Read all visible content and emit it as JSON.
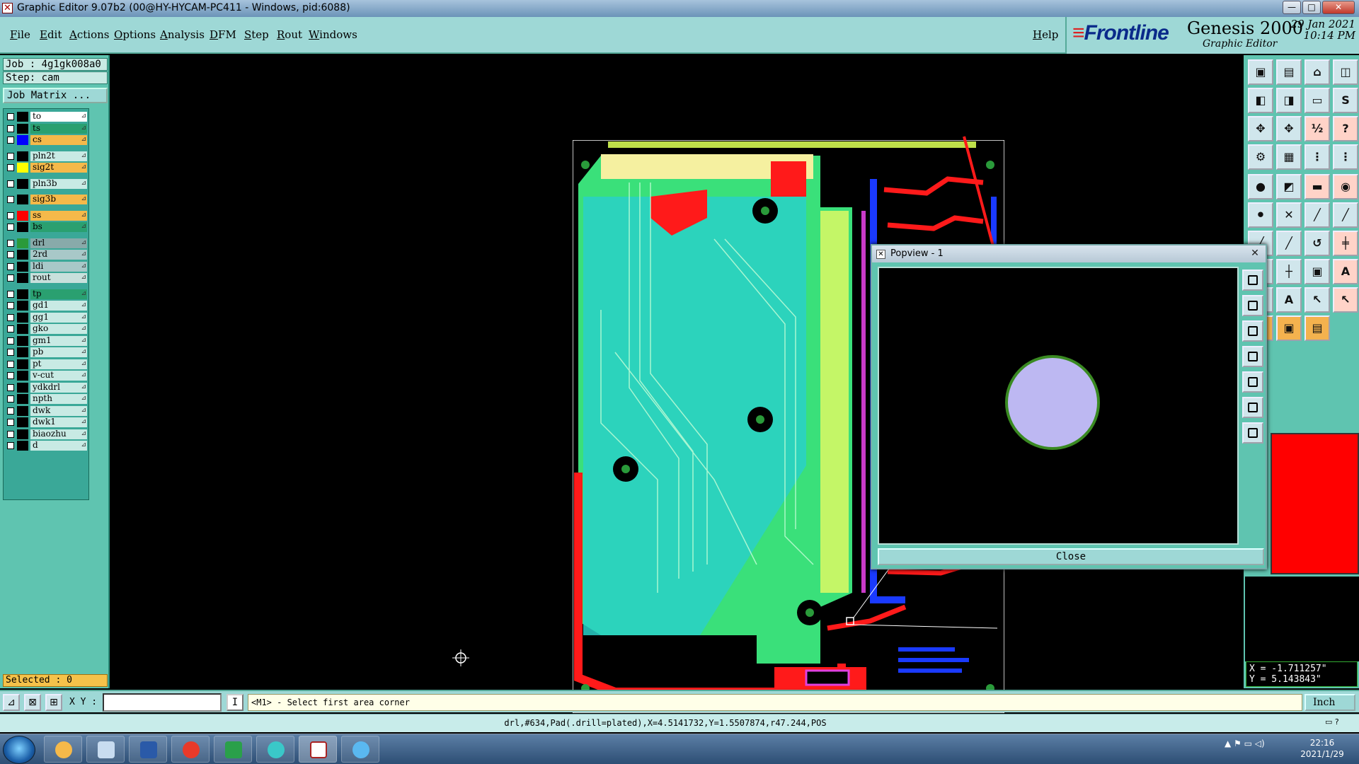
{
  "window": {
    "title": "Graphic Editor 9.07b2 (00@HY-HYCAM-PC411 - Windows, pid:6088)",
    "controls": [
      "—",
      "□",
      "✕"
    ]
  },
  "menu": [
    "File",
    "Edit",
    "Actions",
    "Options",
    "Analysis",
    "DFM",
    "Step",
    "Rout",
    "Windows"
  ],
  "help": "Help",
  "brand": {
    "logo": "Frontline",
    "product": "Genesis 2000",
    "subtitle": "Graphic Editor",
    "date": "29 Jan 2021",
    "time": "10:14 PM"
  },
  "job": {
    "job_line": "Job : 4g1gk008a0",
    "step_line": "Step: cam",
    "matrix_button": "Job Matrix ..."
  },
  "layers": [
    {
      "name": "to",
      "color": "#ffffff",
      "swatch": "#000000"
    },
    {
      "name": "ts",
      "color": "#2aa070",
      "swatch": "#000000"
    },
    {
      "name": "cs",
      "color": "#f5b94a",
      "swatch": "#0000ff"
    },
    {
      "name": "pln2t",
      "color": "#c8eae4",
      "swatch": "#000000"
    },
    {
      "name": "sig2t",
      "color": "#f5b94a",
      "swatch": "#ffff00"
    },
    {
      "name": "pln3b",
      "color": "#c8eae4",
      "swatch": "#000000"
    },
    {
      "name": "sig3b",
      "color": "#f5b94a",
      "swatch": "#000000"
    },
    {
      "name": "ss",
      "color": "#f5b94a",
      "swatch": "#ff0000"
    },
    {
      "name": "bs",
      "color": "#2aa070",
      "swatch": "#000000"
    },
    {
      "name": "drl",
      "color": "#8aa",
      "swatch": "#2a9a3a"
    },
    {
      "name": "2rd",
      "color": "#a8c8c8",
      "swatch": "#000000"
    },
    {
      "name": "ldi",
      "color": "#a8c8c8",
      "swatch": "#000000"
    },
    {
      "name": "rout",
      "color": "#c8e0dc",
      "swatch": "#000000"
    },
    {
      "name": "tp",
      "color": "#2aa070",
      "swatch": "#000000"
    },
    {
      "name": "gd1",
      "color": "#c8eae4",
      "swatch": "#000000"
    },
    {
      "name": "gg1",
      "color": "#c8eae4",
      "swatch": "#000000"
    },
    {
      "name": "gko",
      "color": "#c8eae4",
      "swatch": "#000000"
    },
    {
      "name": "gm1",
      "color": "#c8eae4",
      "swatch": "#000000"
    },
    {
      "name": "pb",
      "color": "#c8eae4",
      "swatch": "#000000"
    },
    {
      "name": "pt",
      "color": "#c8eae4",
      "swatch": "#000000"
    },
    {
      "name": "v-cut",
      "color": "#c8eae4",
      "swatch": "#000000"
    },
    {
      "name": "ydkdrl",
      "color": "#c8eae4",
      "swatch": "#000000"
    },
    {
      "name": "npth",
      "color": "#c8eae4",
      "swatch": "#000000"
    },
    {
      "name": "dwk",
      "color": "#c8eae4",
      "swatch": "#000000"
    },
    {
      "name": "dwk1",
      "color": "#c8eae4",
      "swatch": "#000000"
    },
    {
      "name": "biaozhu",
      "color": "#c8eae4",
      "swatch": "#000000"
    },
    {
      "name": "d",
      "color": "#c8eae4",
      "swatch": "#000000"
    }
  ],
  "selected": "Selected : 0",
  "popview": {
    "title": "Popview - 1",
    "close_button": "Close",
    "pad_color": "#bdb8f2",
    "pad_outline": "#3a8a22"
  },
  "coords": {
    "x": "X = -1.711257\"",
    "y": "Y = 5.143843\""
  },
  "command": {
    "xy_label": "X Y :",
    "xy_value": "",
    "ibtn": "I",
    "prompt": "<M1> - Select first area corner",
    "units": "Inch"
  },
  "status": "drl,#634,Pad(.drill=plated),X=4.5141732,Y=1.5507874,r47.244,POS",
  "taskbar": {
    "time": "22:16",
    "date": "2021/1/29"
  },
  "colors": {
    "panel": "#5fc4b0",
    "menubar": "#9ed8d6",
    "board_green": "#3ae07a",
    "board_cyan": "#2ad0c8",
    "trace_red": "#ff1a1a",
    "trace_blue": "#1a3aff",
    "via_magenta": "#e040e0",
    "arrow": "#ff1a1a"
  }
}
